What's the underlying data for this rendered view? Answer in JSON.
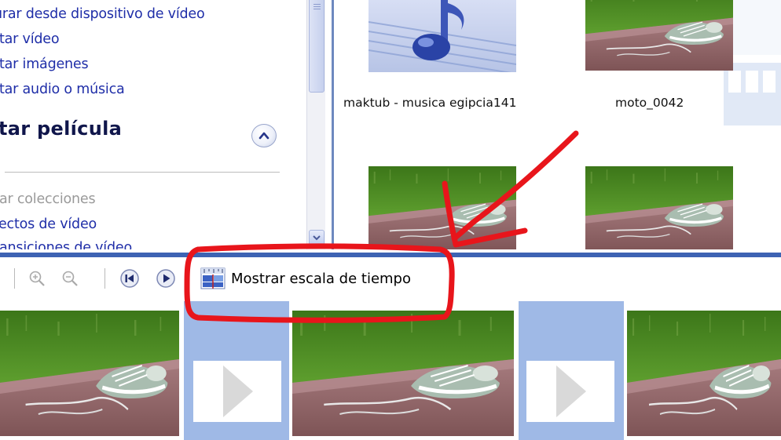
{
  "tasks": {
    "capture_items": [
      "urar desde dispositivo de vídeo",
      "rtar vídeo",
      "rtar imágenes",
      "rtar audio o música"
    ],
    "edit_section_title": "tar película",
    "edit_items": [
      "rar colecciones",
      "fectos de vídeo",
      "ransiciones de vídeo"
    ]
  },
  "collection": {
    "items": [
      {
        "label": "maktub - musica egipcia141",
        "kind": "music-icon"
      },
      {
        "label": "moto_0042",
        "kind": "photo"
      },
      {
        "label": "",
        "kind": "photo"
      },
      {
        "label": "",
        "kind": "photo"
      }
    ]
  },
  "toolbar": {
    "timeline_label": "Mostrar escala de tiempo",
    "icons": [
      "zoom-in-icon",
      "zoom-out-icon",
      "rewind-icon",
      "play-icon",
      "timeline-icon"
    ]
  },
  "storyboard": {
    "slots": [
      "clip",
      "transition",
      "clip",
      "transition",
      "clip"
    ]
  },
  "colors": {
    "link": "#1f2ea8",
    "disabled": "#9a9a9a",
    "splitter": "#3d63b3",
    "storyboard_transition": "#9fb9e6",
    "annotation": "#e8151b"
  }
}
